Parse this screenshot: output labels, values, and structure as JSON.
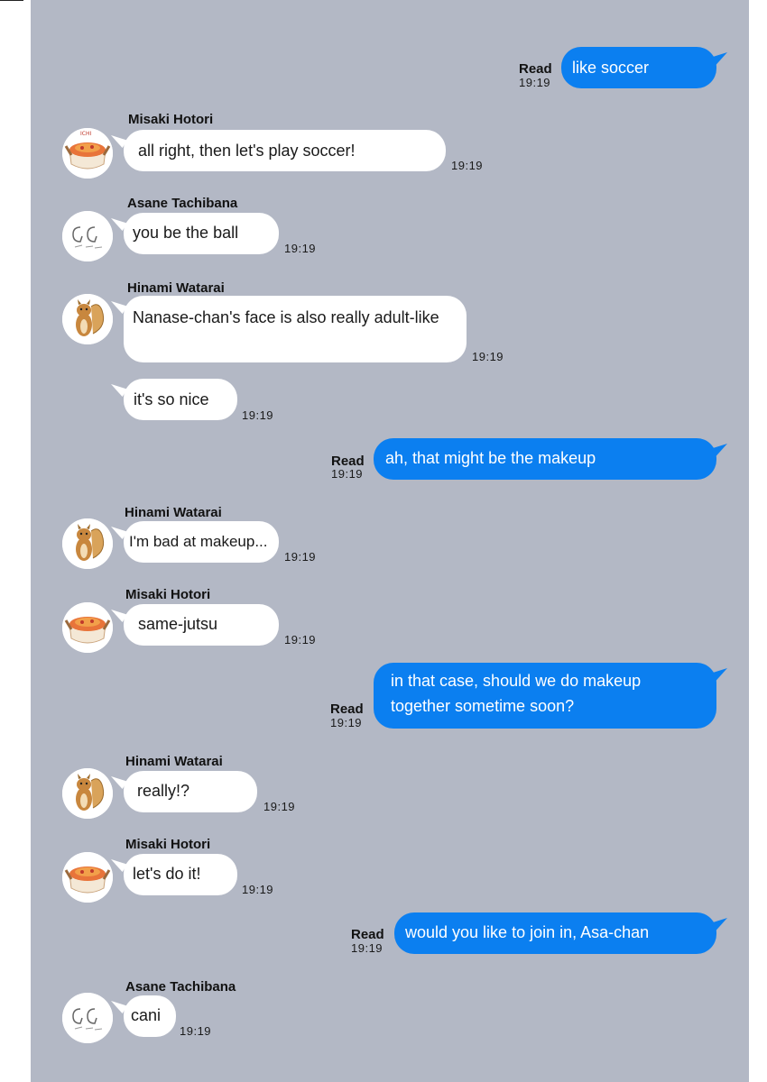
{
  "read_label": "Read",
  "messages": [
    {
      "text": "like soccer",
      "time": "19:19"
    },
    {
      "name": "Misaki Hotori",
      "text": "all right, then let's play soccer!",
      "time": "19:19"
    },
    {
      "name": "Asane Tachibana",
      "text": "you be the ball",
      "time": "19:19"
    },
    {
      "name": "Hinami Watarai",
      "text": "Nanase-chan's face is also really adult-like",
      "time": "19:19"
    },
    {
      "text": "it's so nice",
      "time": "19:19"
    },
    {
      "text": "ah, that might be the makeup",
      "time": "19:19"
    },
    {
      "name": "Hinami Watarai",
      "text": "I'm bad at makeup...",
      "time": "19:19"
    },
    {
      "name": "Misaki Hotori",
      "text": "same-jutsu",
      "time": "19:19"
    },
    {
      "text_line1": "in that case, should we do makeup",
      "text_line2": "together sometime soon?",
      "time": "19:19"
    },
    {
      "name": "Hinami Watarai",
      "text": "really!?",
      "time": "19:19"
    },
    {
      "name": "Misaki Hotori",
      "text": "let's do it!",
      "time": "19:19"
    },
    {
      "text": "would you like to join in, Asa-chan",
      "time": "19:19"
    },
    {
      "name": "Asane Tachibana",
      "text": "cani",
      "time": "19:19"
    }
  ],
  "avatars": {
    "misaki": "food-bowl-avatar",
    "asane": "gg-sketch-avatar",
    "hinami": "squirrel-avatar"
  },
  "colors": {
    "background": "#b3b8c5",
    "outgoing_bubble": "#0b7ff0",
    "incoming_bubble": "#ffffff"
  }
}
